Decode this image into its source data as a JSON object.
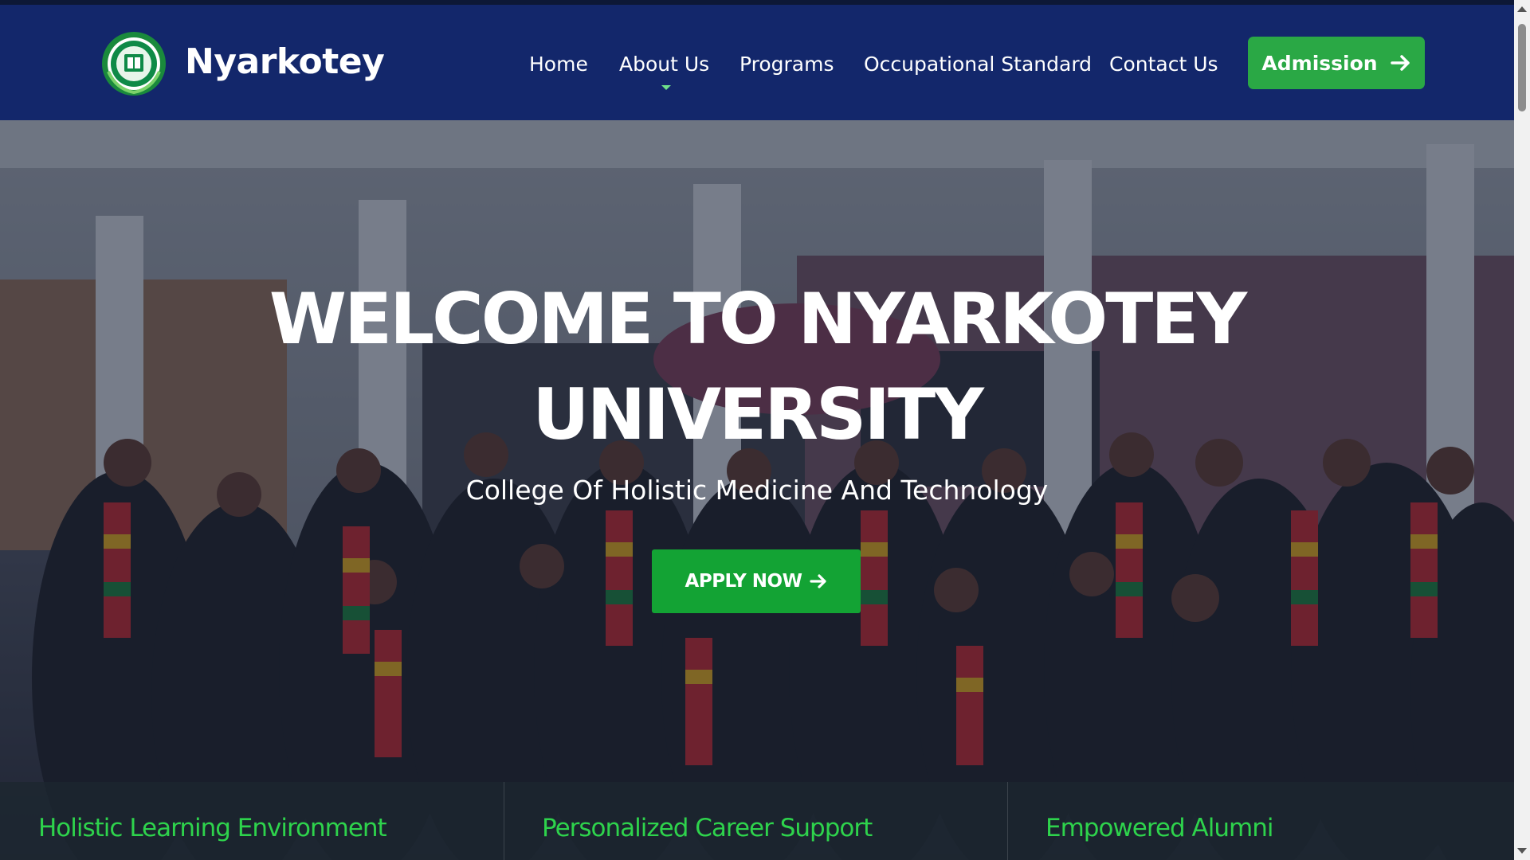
{
  "brand": {
    "name": "Nyarkotey",
    "logo_icon": "university-crest-icon"
  },
  "nav": {
    "items": [
      {
        "label": "Home"
      },
      {
        "label": "About Us"
      },
      {
        "label": "Programs"
      },
      {
        "label": "Occupational Standard"
      },
      {
        "label": "Contact Us"
      }
    ],
    "cta_label": "Admission",
    "cta_icon": "arrow-right-icon"
  },
  "hero": {
    "title_line1": "WELCOME TO NYARKOTEY",
    "title_line2": "UNIVERSITY",
    "subtitle": "College Of Holistic Medicine And Technology",
    "apply_label": "APPLY NOW",
    "apply_icon": "arrow-right-icon",
    "background": "graduation-group-photo"
  },
  "features": [
    {
      "label": "Holistic Learning Environment"
    },
    {
      "label": "Personalized Career Support"
    },
    {
      "label": "Empowered Alumni"
    }
  ],
  "colors": {
    "header_bg": "#13276b",
    "accent_green": "#2aa845",
    "feature_text": "#2ed34c"
  }
}
